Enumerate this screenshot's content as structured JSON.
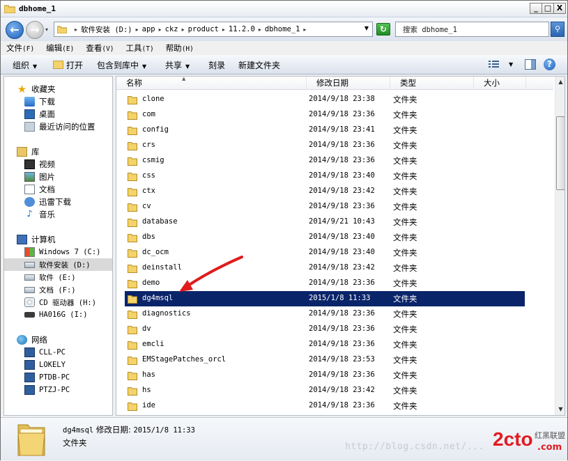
{
  "window": {
    "title": "dbhome_1",
    "min_label": "_",
    "max_label": "□",
    "close_label": "X"
  },
  "nav": {
    "back_label": "←",
    "forward_label": "→",
    "history_label": "▾"
  },
  "address": {
    "breadcrumbs": [
      "软件安装 (D:)",
      "app",
      "ckz",
      "product",
      "11.2.0",
      "dbhome_1"
    ],
    "separator": "▸",
    "dropdown_label": "▼",
    "refresh_label": "↻"
  },
  "search": {
    "placeholder": "搜索 dbhome_1",
    "button_label": "⚲"
  },
  "menu": {
    "items": [
      {
        "label": "文件",
        "key": "(F)"
      },
      {
        "label": "编辑",
        "key": "(E)"
      },
      {
        "label": "查看",
        "key": "(V)"
      },
      {
        "label": "工具",
        "key": "(T)"
      },
      {
        "label": "帮助",
        "key": "(H)"
      }
    ]
  },
  "toolbar": {
    "organize": "组织",
    "open": "打开",
    "include_in_library": "包含到库中",
    "share": "共享",
    "burn": "刻录",
    "new_folder": "新建文件夹",
    "dropdown_arrow": "▼",
    "help_label": "?"
  },
  "sidebar": {
    "favorites": {
      "label": "收藏夹",
      "items": [
        "下载",
        "桌面",
        "最近访问的位置"
      ]
    },
    "libraries": {
      "label": "库",
      "items": [
        "视频",
        "图片",
        "文档",
        "迅雷下载",
        "音乐"
      ]
    },
    "computer": {
      "label": "计算机",
      "items": [
        "Windows 7 (C:)",
        "软件安装 (D:)",
        "软件 (E:)",
        "文档 (F:)",
        "CD 驱动器 (H:)",
        "HA016G (I:)"
      ]
    },
    "network": {
      "label": "网络",
      "items": [
        "CLL-PC",
        "LOKELY",
        "PTDB-PC",
        "PTZJ-PC"
      ]
    },
    "selected": "软件安装 (D:)"
  },
  "columns": {
    "name": "名称",
    "date": "修改日期",
    "type": "类型",
    "size": "大小",
    "sort_indicator": "▲"
  },
  "files": [
    {
      "name": "clone",
      "date": "2014/9/18 23:38",
      "type": "文件夹"
    },
    {
      "name": "com",
      "date": "2014/9/18 23:36",
      "type": "文件夹"
    },
    {
      "name": "config",
      "date": "2014/9/18 23:41",
      "type": "文件夹"
    },
    {
      "name": "crs",
      "date": "2014/9/18 23:36",
      "type": "文件夹"
    },
    {
      "name": "csmig",
      "date": "2014/9/18 23:36",
      "type": "文件夹"
    },
    {
      "name": "css",
      "date": "2014/9/18 23:40",
      "type": "文件夹"
    },
    {
      "name": "ctx",
      "date": "2014/9/18 23:42",
      "type": "文件夹"
    },
    {
      "name": "cv",
      "date": "2014/9/18 23:36",
      "type": "文件夹"
    },
    {
      "name": "database",
      "date": "2014/9/21 10:43",
      "type": "文件夹"
    },
    {
      "name": "dbs",
      "date": "2014/9/18 23:40",
      "type": "文件夹"
    },
    {
      "name": "dc_ocm",
      "date": "2014/9/18 23:40",
      "type": "文件夹"
    },
    {
      "name": "deinstall",
      "date": "2014/9/18 23:42",
      "type": "文件夹"
    },
    {
      "name": "demo",
      "date": "2014/9/18 23:36",
      "type": "文件夹"
    },
    {
      "name": "dg4msql",
      "date": "2015/1/8 11:33",
      "type": "文件夹"
    },
    {
      "name": "diagnostics",
      "date": "2014/9/18 23:36",
      "type": "文件夹"
    },
    {
      "name": "dv",
      "date": "2014/9/18 23:36",
      "type": "文件夹"
    },
    {
      "name": "emcli",
      "date": "2014/9/18 23:36",
      "type": "文件夹"
    },
    {
      "name": "EMStagePatches_orcl",
      "date": "2014/9/18 23:53",
      "type": "文件夹"
    },
    {
      "name": "has",
      "date": "2014/9/18 23:36",
      "type": "文件夹"
    },
    {
      "name": "hs",
      "date": "2014/9/18 23:42",
      "type": "文件夹"
    },
    {
      "name": "ide",
      "date": "2014/9/18 23:36",
      "type": "文件夹"
    }
  ],
  "selected_file": "dg4msql",
  "scroll": {
    "up": "▲",
    "down": "▼"
  },
  "details": {
    "name": "dg4msql",
    "date_label": "修改日期:",
    "date": "2015/1/8 11:33",
    "type": "文件夹"
  },
  "watermark": {
    "url": "http://blog.csdn.net/...",
    "logo": "2cto",
    "logo_sub": "红黑联盟",
    "logo_url": ".com"
  },
  "colors": {
    "selection": "#0a246a",
    "folder": "#f3d36a",
    "arrow": "#e01b1b",
    "logo": "#e11b22"
  }
}
